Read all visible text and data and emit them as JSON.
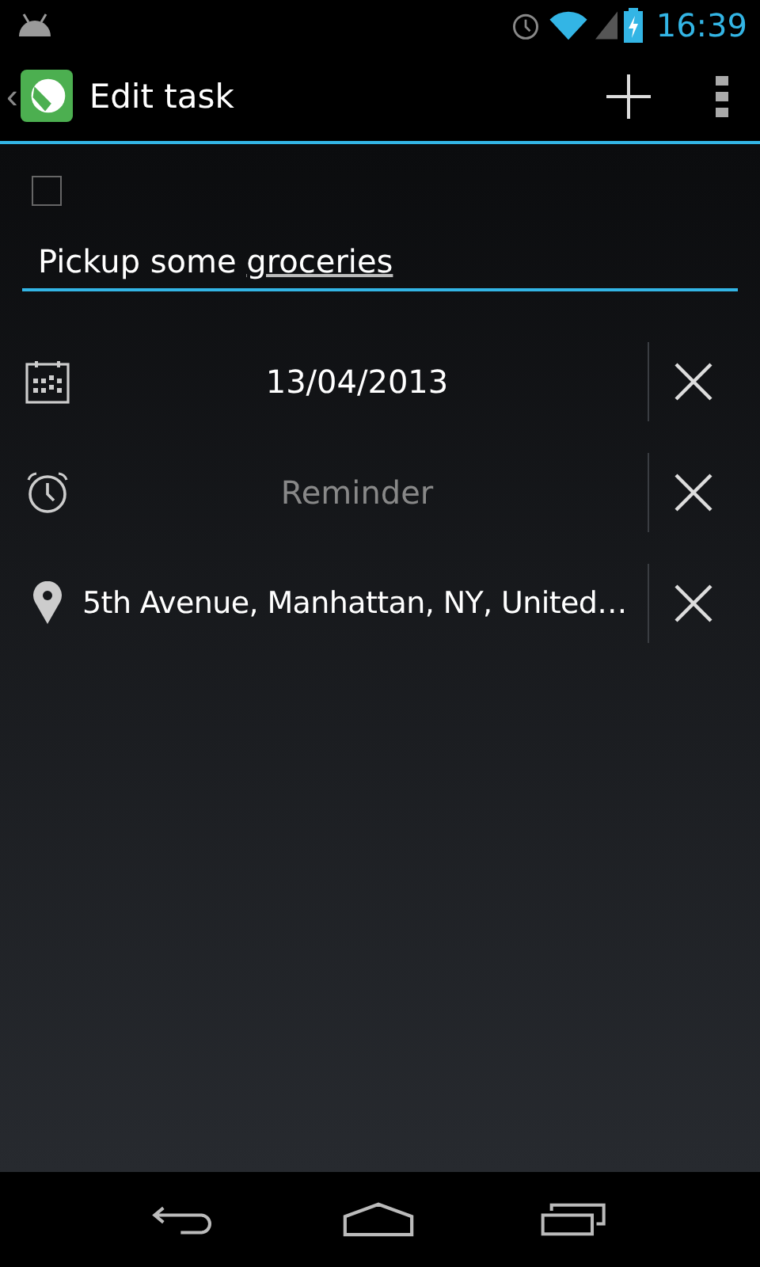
{
  "status_bar": {
    "time": "16:39"
  },
  "action_bar": {
    "back": "‹",
    "title": "Edit task"
  },
  "task": {
    "done": false,
    "title_parts": [
      {
        "text": "Pickup some ",
        "underlined": false
      },
      {
        "text": "groceries",
        "underlined": true
      }
    ]
  },
  "fields": [
    {
      "kind": "date",
      "value": "13/04/2013"
    },
    {
      "kind": "reminder",
      "placeholder": "Reminder"
    },
    {
      "kind": "location",
      "value": "5th Avenue, Manhattan, NY, United…"
    }
  ]
}
